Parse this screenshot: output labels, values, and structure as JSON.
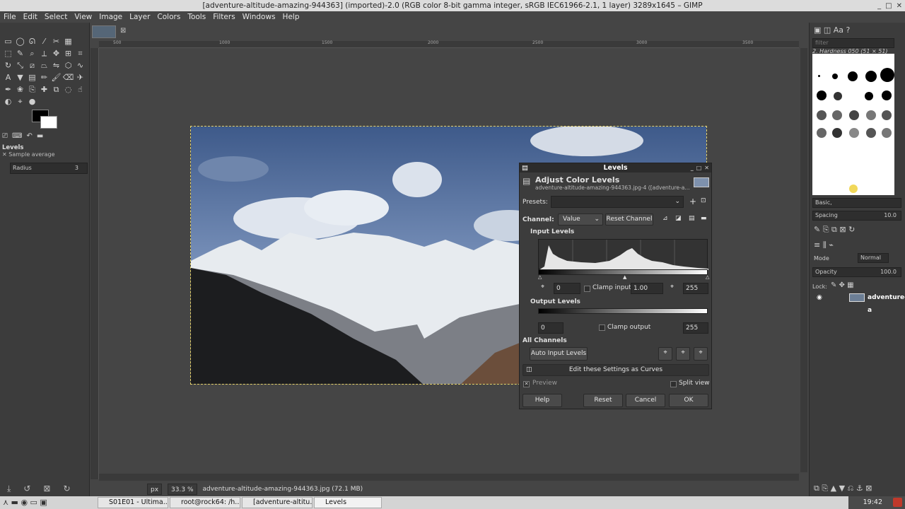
{
  "window": {
    "title": "[adventure-altitude-amazing-944363] (imported)-2.0 (RGB color 8-bit gamma integer, sRGB IEC61966-2.1, 1 layer) 3289x1645 – GIMP"
  },
  "menu": [
    "File",
    "Edit",
    "Select",
    "View",
    "Image",
    "Layer",
    "Colors",
    "Tools",
    "Filters",
    "Windows",
    "Help"
  ],
  "tool_options": {
    "title": "Levels",
    "sample_average": "Sample average",
    "radius_label": "Radius",
    "radius_value": "3"
  },
  "ruler": {
    "ticks": [
      "500",
      "1000",
      "1500",
      "2000",
      "2500",
      "3000",
      "3500"
    ]
  },
  "status": {
    "unit": "px",
    "zoom": "33.3 %",
    "info": "adventure-altitude-amazing-944363.jpg (72.1 MB)"
  },
  "right_panel": {
    "filter_placeholder": "filter",
    "brush_name": "2. Hardness 050 (51 × 51)",
    "brush_set": "Basic,",
    "spacing_label": "Spacing",
    "spacing_value": "10.0",
    "mode_label": "Mode",
    "mode_value": "Normal",
    "opacity_label": "Opacity",
    "opacity_value": "100.0",
    "lock_label": "Lock:",
    "layer_name": "adventure-a"
  },
  "dialog": {
    "window_title": "Levels",
    "heading": "Adjust Color Levels",
    "subheading": "adventure-altitude-amazing-944363.jpg-4 ([adventure-a...",
    "presets_label": "Presets:",
    "channel_label": "Channel:",
    "channel_value": "Value",
    "reset_channel": "Reset Channel",
    "input_levels": "Input Levels",
    "input_low": "0",
    "clamp_input": "Clamp input",
    "gamma": "1.00",
    "input_high": "255",
    "output_levels": "Output Levels",
    "output_low": "0",
    "clamp_output": "Clamp output",
    "output_high": "255",
    "all_channels": "All Channels",
    "auto_input": "Auto Input Levels",
    "edit_curves": "Edit these Settings as Curves",
    "preview": "Preview",
    "split_view": "Split view",
    "help": "Help",
    "reset": "Reset",
    "cancel": "Cancel",
    "ok": "OK"
  },
  "taskbar": {
    "items": [
      "S01E01 - Ultima...",
      "root@rock64: /h...",
      "[adventure-altitu...",
      "Levels"
    ],
    "clock": "19:42"
  }
}
